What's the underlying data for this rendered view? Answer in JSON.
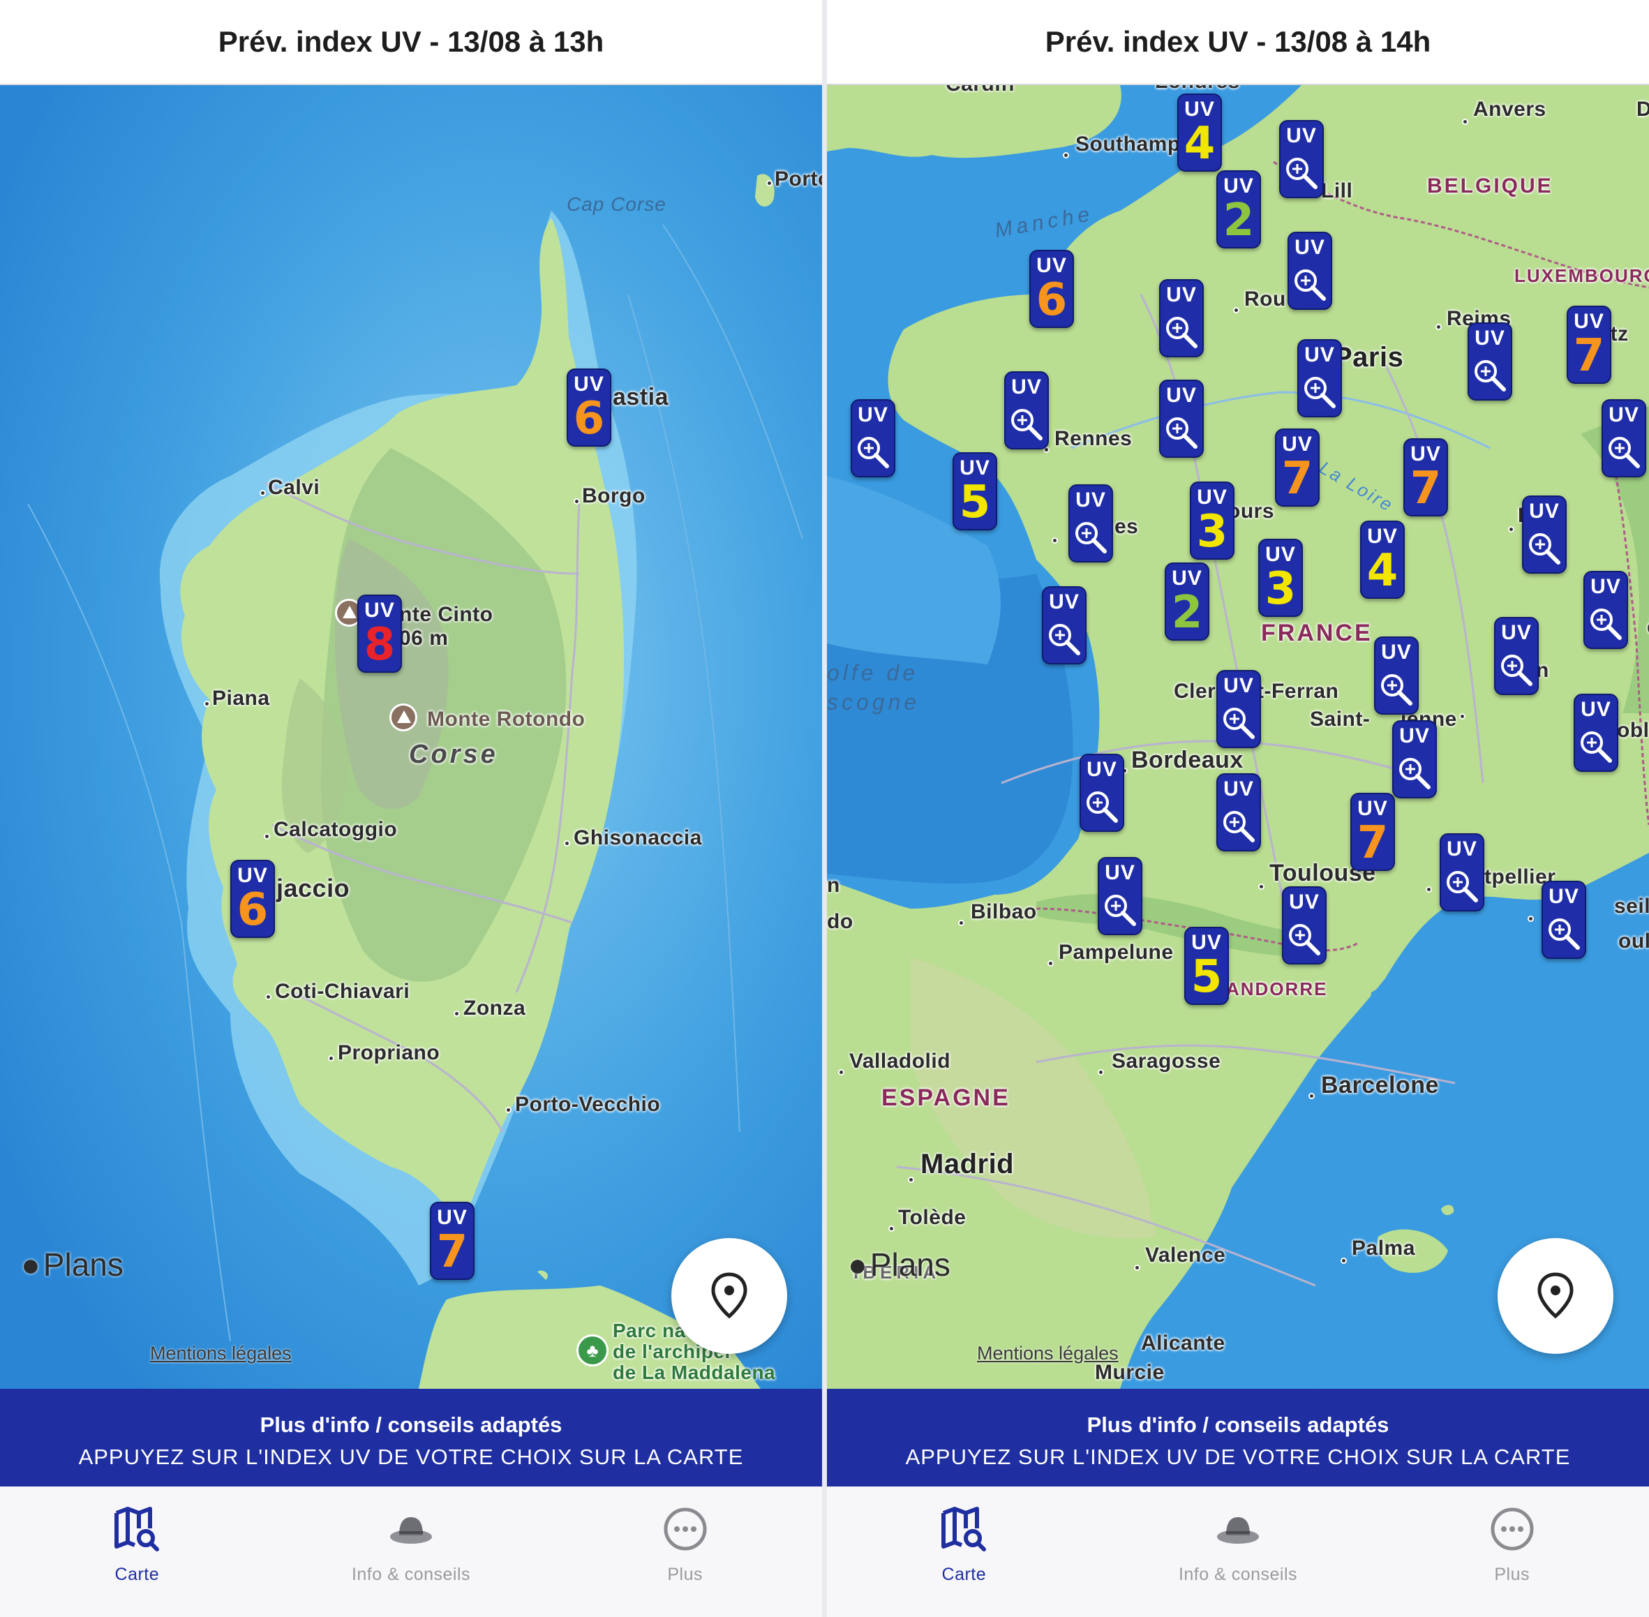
{
  "left_screen": {
    "title": "Prév. index UV - 13/08 à 13h",
    "map": {
      "places": {
        "porto": "Porto",
        "cap_corse": "Cap Corse",
        "bastia": "astia",
        "borgo": "Borgo",
        "calvi": "Calvi",
        "monte_cinto": "nte Cinto",
        "monte_cinto_alt": "06 m",
        "piana": "Piana",
        "monte_rotondo": "Monte Rotondo",
        "corse": "Corse",
        "calcatoggio": "Calcatoggio",
        "ghisonaccia": "Ghisonaccia",
        "ajaccio": "jaccio",
        "coti_chiavari": "Coti-Chiavari",
        "zonza": "Zonza",
        "propriano": "Propriano",
        "porto_vecchio": "Porto-Vecchio",
        "parc_line1": "Parc na",
        "parc_line2": "de l'archipel",
        "parc_line3": "de La Maddalena"
      },
      "uv_markers": [
        {
          "label": "UV",
          "value": "6",
          "color": "#f7941d"
        },
        {
          "label": "UV",
          "value": "8",
          "color": "#e8232a"
        },
        {
          "label": "UV",
          "value": "6",
          "color": "#f7941d"
        },
        {
          "label": "UV",
          "value": "7",
          "color": "#f7941d"
        }
      ],
      "attribution": {
        "logo": "Plans",
        "legal": "Mentions légales"
      },
      "locate_icon": "location-pin-icon"
    },
    "banner": {
      "line1": "Plus d'info / conseils adaptés",
      "line2": "APPUYEZ SUR L'INDEX UV DE VOTRE CHOIX SUR LA CARTE"
    },
    "tabs": [
      {
        "label": "Carte",
        "icon": "map-search-icon",
        "active": true
      },
      {
        "label": "Info & conseils",
        "icon": "hat-icon",
        "active": false
      },
      {
        "label": "Plus",
        "icon": "more-icon",
        "active": false
      }
    ]
  },
  "right_screen": {
    "title": "Prév. index UV - 13/08 à 14h",
    "map": {
      "places": {
        "cardiff": "Cardiff",
        "londres": "Londres",
        "anvers": "Anvers",
        "d_edge": "D",
        "southampton": "Southampton",
        "lille": "Lill",
        "belgique": "BELGIQUE",
        "manche": "Manche",
        "luxembourg": "LUXEMBOURG",
        "rouen": "Rou",
        "reims": "Reims",
        "metz": "Metz",
        "paris": "Paris",
        "rennes": "Rennes",
        "tours": "ours",
        "la_loire": "La Loire",
        "nantes": "es",
        "dijon": "D",
        "france": "FRANCE",
        "golfe_line1": "olfe de",
        "golfe_line2": "scogne",
        "clermont": "Cler",
        "clermont2": "t-Ferran",
        "lyon": "yon",
        "saint_etienne": "Saint-",
        "saint_etienne2": "ienne",
        "grenoble": "obl",
        "bordeaux": "Bordeaux",
        "toulouse": "Toulouse",
        "montpellier": "tpellier",
        "marseille": "seille",
        "toulon": "oulon",
        "bilbao": "Bilbao",
        "pampelune": "Pampelune",
        "andorre": "ANDORRE",
        "left_n": "n",
        "left_do": "do",
        "valladolid": "Valladolid",
        "espagne": "ESPAGNE",
        "saragosse": "Saragosse",
        "barcelone": "Barcelone",
        "madrid": "Madrid",
        "tolede": "Tolède",
        "iberia": "IBERIA",
        "valence": "Valence",
        "palma": "Palma",
        "alicante": "Alicante",
        "murcie": "Murcie",
        "e_edge": "è"
      },
      "uv_markers": [
        {
          "label": "UV",
          "value": "4",
          "color": "#f2e600"
        },
        {
          "label": "UV",
          "value": "2",
          "color": "#8cc63f"
        },
        {
          "label": "UV",
          "value": "6",
          "color": "#f7941d"
        },
        {
          "label": "UV",
          "value": "7",
          "color": "#f7941d"
        },
        {
          "label": "UV",
          "value": "5",
          "color": "#f2e600"
        },
        {
          "label": "UV",
          "value": "7",
          "color": "#f7941d"
        },
        {
          "label": "UV",
          "value": "7",
          "color": "#f7941d"
        },
        {
          "label": "UV",
          "value": "3",
          "color": "#f2e600"
        },
        {
          "label": "UV",
          "value": "4",
          "color": "#f2e600"
        },
        {
          "label": "UV",
          "value": "3",
          "color": "#f2e600"
        },
        {
          "label": "UV",
          "value": "2",
          "color": "#8cc63f"
        },
        {
          "label": "UV",
          "value": "7",
          "color": "#f7941d"
        },
        {
          "label": "UV",
          "value": "5",
          "color": "#f2e600"
        }
      ],
      "zoom_marker_label": "UV",
      "zoom_icon": "zoom-in-icon",
      "attribution": {
        "logo": "Plans",
        "legal": "Mentions légales"
      },
      "locate_icon": "location-pin-icon"
    },
    "banner": {
      "line1": "Plus d'info / conseils adaptés",
      "line2": "APPUYEZ SUR L'INDEX UV DE VOTRE CHOIX SUR LA CARTE"
    },
    "tabs": [
      {
        "label": "Carte",
        "icon": "map-search-icon",
        "active": true
      },
      {
        "label": "Info & conseils",
        "icon": "hat-icon",
        "active": false
      },
      {
        "label": "Plus",
        "icon": "more-icon",
        "active": false
      }
    ]
  },
  "colors": {
    "accent": "#1f2ea0",
    "sea": "#3a9be0",
    "land": "#b5dc8f",
    "uv_orange": "#f7941d",
    "uv_red": "#e8232a",
    "uv_yellow": "#f2e600",
    "uv_green": "#8cc63f"
  }
}
